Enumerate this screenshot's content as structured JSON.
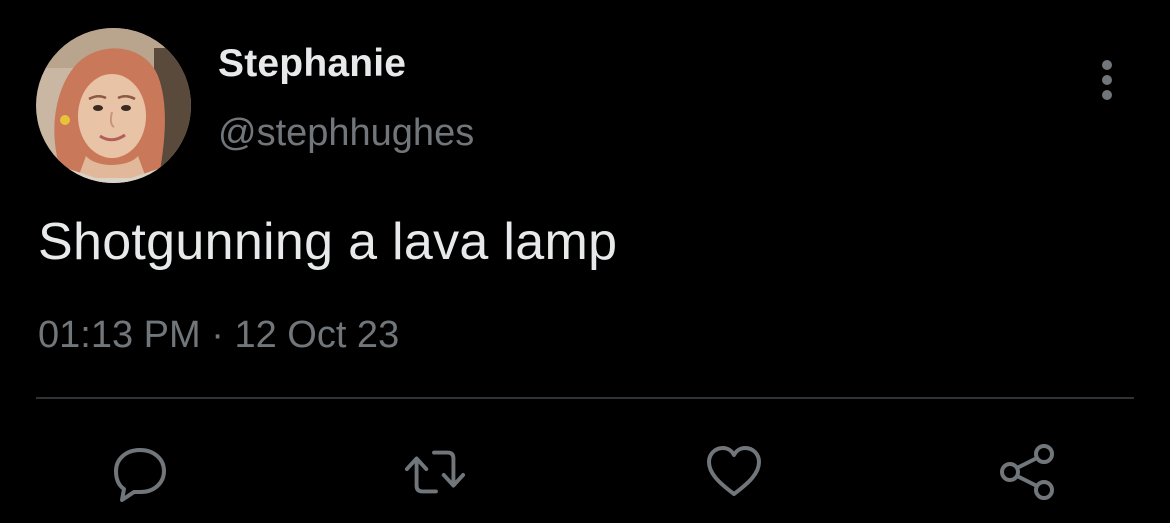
{
  "tweet": {
    "author": {
      "display_name": "Stephanie",
      "handle": "@stephhughes",
      "avatar": "profile-photo"
    },
    "text": "Shotgunning a lava lamp",
    "time": "01:13 PM",
    "separator": "·",
    "date": "12 Oct 23",
    "actions": [
      "reply-icon",
      "retweet-icon",
      "like-icon",
      "share-icon"
    ],
    "more_icon": "more-vertical-icon"
  },
  "colors": {
    "background": "#000000",
    "text_primary": "#e7e9ea",
    "text_secondary": "#71767b",
    "divider": "#2f3336"
  }
}
